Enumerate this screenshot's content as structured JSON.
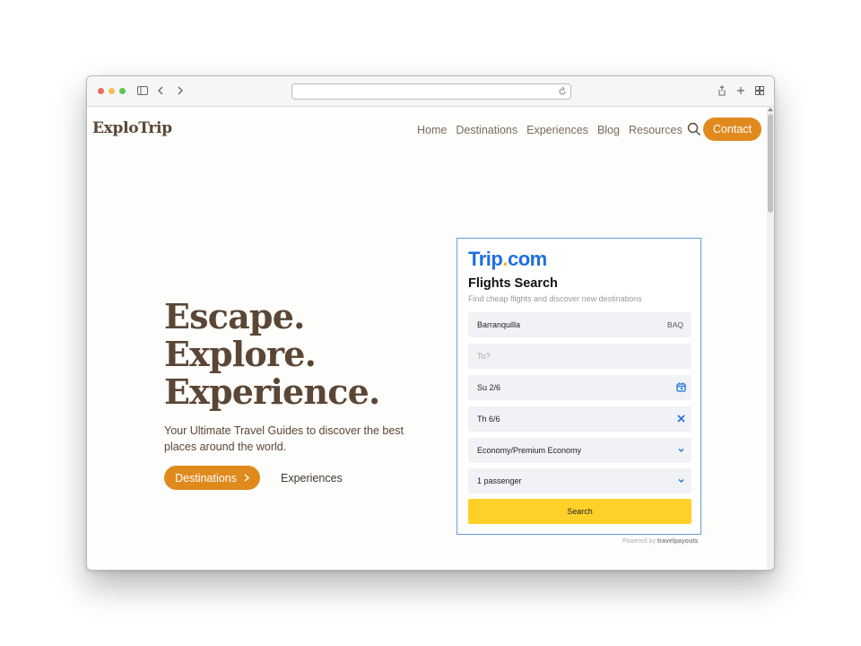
{
  "site": {
    "brand": "ExploTrip",
    "nav": [
      {
        "label": "Home"
      },
      {
        "label": "Destinations"
      },
      {
        "label": "Experiences"
      },
      {
        "label": "Blog"
      },
      {
        "label": "Resources"
      }
    ],
    "contact_label": "Contact"
  },
  "hero": {
    "lines": [
      "Escape.",
      "Explore.",
      "Experience."
    ],
    "subtitle": "Your Ultimate Travel Guides to discover the best places around the world.",
    "primary_button": "Destinations",
    "secondary_link": "Experiences"
  },
  "widget": {
    "logo_main": "Trip",
    "logo_dot": ".",
    "logo_end": "com",
    "title": "Flights Search",
    "subtitle": "Find cheap flights and discover new destinations",
    "from_value": "Barranquilla",
    "from_code": "BAQ",
    "to_placeholder": "To?",
    "depart_date": "Su 2/6",
    "return_date": "Th 6/6",
    "cabin_class": "Economy/Premium Economy",
    "passengers": "1 passenger",
    "search_label": "Search",
    "powered_prefix": "Powered by",
    "powered_brand": "travelpayouts"
  },
  "colors": {
    "brand_brown": "#5b4636",
    "accent_orange": "#e08a1e",
    "trip_blue": "#1e6fe0",
    "search_yellow": "#ffd128"
  }
}
